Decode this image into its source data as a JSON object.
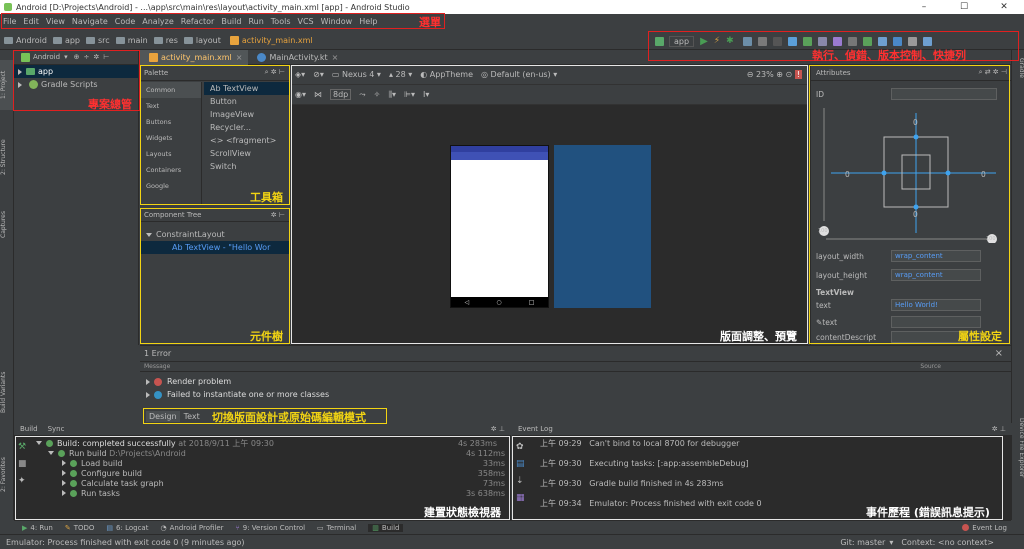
{
  "window": {
    "title": "Android [D:\\Projects\\Android] - ...\\app\\src\\main\\res\\layout\\activity_main.xml [app] - Android Studio"
  },
  "menu": {
    "items": [
      "File",
      "Edit",
      "View",
      "Navigate",
      "Code",
      "Analyze",
      "Refactor",
      "Build",
      "Run",
      "Tools",
      "VCS",
      "Window",
      "Help"
    ]
  },
  "nav": {
    "crumbs": [
      "Android",
      "app",
      "src",
      "main",
      "res",
      "layout",
      "activity_main.xml"
    ],
    "run_config": "app"
  },
  "project": {
    "view_mode": "Android",
    "items": [
      "app",
      "Gradle Scripts"
    ]
  },
  "editor_tabs": [
    "activity_main.xml",
    "MainActivity.kt"
  ],
  "palette": {
    "title": "Palette",
    "categories": [
      "Common",
      "Text",
      "Buttons",
      "Widgets",
      "Layouts",
      "Containers",
      "Google"
    ],
    "items": [
      "Ab TextView",
      "Button",
      "ImageView",
      "Recycler...",
      "<> <fragment>",
      "ScrollView",
      "Switch"
    ]
  },
  "component_tree": {
    "title": "Component Tree",
    "root": "ConstraintLayout",
    "child": "Ab TextView - \"Hello Wor"
  },
  "design_toolbar": {
    "device": "Nexus 4",
    "api": "28",
    "theme": "AppTheme",
    "locale": "Default (en-us)",
    "zoom": "23%",
    "margin": "8dp"
  },
  "attributes": {
    "title": "Attributes",
    "id_label": "ID",
    "margin_top": "0",
    "margin_left": "0",
    "margin_right": "0",
    "margin_bottom": "0",
    "bias_left": "100",
    "bias_right": "100",
    "layout_width_label": "layout_width",
    "layout_width": "wrap_content",
    "layout_height_label": "layout_height",
    "layout_height": "wrap_content",
    "section": "TextView",
    "text_label": "text",
    "text_value": "Hello World!",
    "text2_label": "text",
    "contentdesc_label": "contentDescript"
  },
  "errors": {
    "title": "1 Error",
    "col_message": "Message",
    "col_source": "Source",
    "rows": [
      "Render problem",
      "Failed to instantiate one or more classes"
    ]
  },
  "mode_toggle": {
    "design": "Design",
    "text": "Text"
  },
  "build": {
    "tab_build": "Build",
    "tab_sync": "Sync",
    "rows": [
      {
        "label": "Build: completed successfully",
        "extra": "at 2018/9/11 上午 09:30",
        "time": "4s 283ms"
      },
      {
        "label": "Run build",
        "extra": "D:\\Projects\\Android",
        "time": "4s 112ms"
      },
      {
        "label": "Load build",
        "extra": "",
        "time": "33ms"
      },
      {
        "label": "Configure build",
        "extra": "",
        "time": "358ms"
      },
      {
        "label": "Calculate task graph",
        "extra": "",
        "time": "73ms"
      },
      {
        "label": "Run tasks",
        "extra": "",
        "time": "3s 638ms"
      }
    ]
  },
  "event_log": {
    "title": "Event Log",
    "rows": [
      {
        "time": "上午 09:29",
        "msg": "Can't bind to local 8700 for debugger"
      },
      {
        "time": "上午 09:30",
        "msg": "Executing tasks: [:app:assembleDebug]"
      },
      {
        "time": "上午 09:30",
        "msg": "Gradle build finished in 4s 283ms"
      },
      {
        "time": "上午 09:34",
        "msg": "Emulator: Process finished with exit code 0"
      }
    ]
  },
  "bottom_tabs": [
    "4: Run",
    "TODO",
    "6: Logcat",
    "Android Profiler",
    "9: Version Control",
    "Terminal",
    "Build"
  ],
  "event_log_tab": "Event Log",
  "status": {
    "message": "Emulator: Process finished with exit code 0 (9 minutes ago)",
    "git": "Git: master",
    "context": "Context: <no context>"
  },
  "side_tabs": {
    "left": [
      "1: Project",
      "2: Structure",
      "Captures",
      "Build Variants",
      "2: Favorites"
    ],
    "right": [
      "Gradle",
      "Device File Explorer"
    ]
  },
  "annotations": {
    "menu": "選單",
    "toolbar": "執行、偵錯、版本控制、快捷列",
    "project": "專案總管",
    "palette": "工具箱",
    "tree": "元件樹",
    "preview": "版面調整、預覽",
    "attributes": "屬性設定",
    "mode": "切換版面設計或原始碼編輯模式",
    "build": "建置狀態檢視器",
    "events": "事件歷程 (錯誤訊息提示)"
  },
  "colors": {
    "annotation_red": "#e02020",
    "annotation_yellow": "#f2d413",
    "annotation_white": "#e6e6e6",
    "ide_bg": "#3c3f41",
    "editor_bg": "#2b2b2b",
    "blueprint": "#21517f"
  }
}
